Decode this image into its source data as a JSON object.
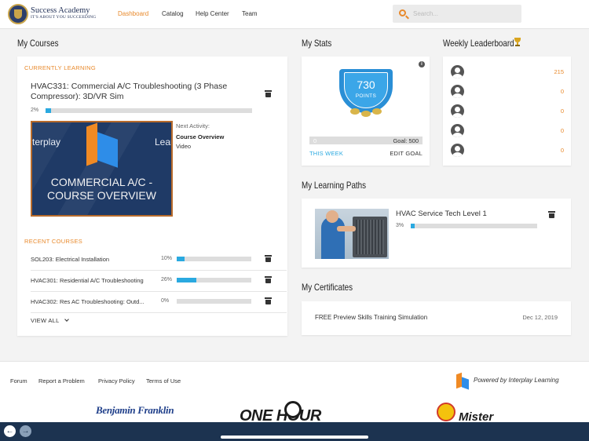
{
  "header": {
    "brand_name": "Success Academy",
    "brand_tagline": "IT'S ABOUT YOU SUCCEEDING",
    "nav": [
      "Dashboard",
      "Catalog",
      "Help Center",
      "Team"
    ],
    "active_nav": "Dashboard",
    "search_placeholder": "Search..."
  },
  "my_courses": {
    "title": "My Courses",
    "currently_learning_label": "CURRENTLY LEARNING",
    "current": {
      "title": "HVAC331: Commercial A/C Troubleshooting (3 Phase Compressor): 3D/VR Sim",
      "progress_text": "2%",
      "progress": 2,
      "thumb_brand_left": "terplay",
      "thumb_brand_right": "Learnin",
      "thumb_text": "COMMERCIAL A/C - COURSE OVERVIEW",
      "next_activity_label": "Next Activity:",
      "next_activity_title": "Course Overview",
      "next_activity_type": "Video"
    },
    "recent_label": "RECENT COURSES",
    "recent": [
      {
        "name": "SOL203: Electrical Installation",
        "pct": "10%",
        "progress": 10
      },
      {
        "name": "HVAC301: Residential A/C Troubleshooting",
        "pct": "26%",
        "progress": 26
      },
      {
        "name": "HVAC302: Res AC Troubleshooting: Outd...",
        "pct": "0%",
        "progress": 0
      }
    ],
    "view_all": "VIEW ALL"
  },
  "my_stats": {
    "title": "My Stats",
    "points": "730",
    "points_label": "POINTS",
    "week_value": "0",
    "week_progress": 0,
    "goal_text": "Goal: 500",
    "this_week": "THIS WEEK",
    "edit_goal": "EDIT GOAL"
  },
  "leaderboard": {
    "title": "Weekly Leaderboard",
    "scores": [
      "215",
      "0",
      "0",
      "0",
      "0"
    ]
  },
  "learning_paths": {
    "title": "My Learning Paths",
    "items": [
      {
        "title": "HVAC Service Tech Level 1",
        "pct": "3%",
        "progress": 3
      }
    ]
  },
  "certificates": {
    "title": "My Certificates",
    "items": [
      {
        "name": "FREE Preview Skills Training Simulation",
        "date": "Dec 12, 2019"
      }
    ]
  },
  "footer": {
    "links": [
      "Forum",
      "Report a Problem",
      "Privacy Policy",
      "Terms of Use"
    ],
    "powered_by": "Powered by Interplay Learning",
    "sponsors": [
      "Benjamin Franklin",
      "ONE HOUR",
      "Mister"
    ]
  },
  "colors": {
    "accent": "#e8892b",
    "progress": "#2aa9e0",
    "bottom_bar": "#1c3350"
  },
  "icons": [
    "search-icon",
    "trash-icon",
    "info-icon",
    "trophy-icon",
    "avatar-icon",
    "chevron-down-icon",
    "back-arrow-icon",
    "forward-arrow-icon"
  ]
}
